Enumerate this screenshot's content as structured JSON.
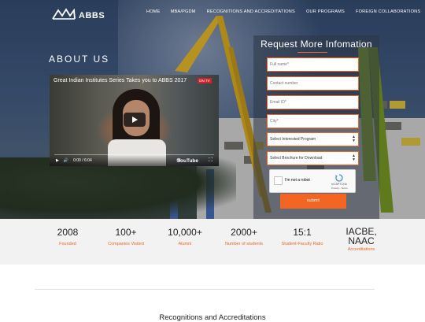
{
  "brand": {
    "name": "ABBS"
  },
  "nav": [
    {
      "label": "HOME"
    },
    {
      "label": "MBA/PGDM"
    },
    {
      "label": "RECOGNITIONS AND ACCREDITATIONS"
    },
    {
      "label": "OUR PROGRAMS"
    },
    {
      "label": "FOREIGN COLLABORATIONS"
    }
  ],
  "hero": {
    "heading": "ABOUT US"
  },
  "video": {
    "title": "Great Indian Institutes Series Takes you to ABBS 2017",
    "badge": "ON TV",
    "time": "0:00 / 6:04",
    "brand": "YouTube"
  },
  "form": {
    "title": "Request More Infomation",
    "fields": [
      {
        "placeholder": "Full name*"
      },
      {
        "placeholder": "Contact number"
      },
      {
        "placeholder": "Email ID*"
      },
      {
        "placeholder": "City*"
      }
    ],
    "program_select": "Select Interested Program",
    "brochure_select": "Select Brochure for Download",
    "captcha_label": "I'm not a robot",
    "captcha_brand": "reCAPTCHA",
    "captcha_links": "Privacy - Terms",
    "submit_label": "submit"
  },
  "stats": [
    {
      "value": "2008",
      "caption": "Founded"
    },
    {
      "value": "100+",
      "caption": "Companies Visited"
    },
    {
      "value": "10,000+",
      "caption": "Alumni"
    },
    {
      "value": "2000+",
      "caption": "Number of students"
    },
    {
      "value": "15:1",
      "caption": "Student-Faculty Ratio"
    },
    {
      "value": "IACBE, NAAC",
      "caption": "Accreditations"
    }
  ],
  "section": {
    "heading": "Recognitions and Accreditations"
  },
  "colors": {
    "accent": "#f26522"
  }
}
